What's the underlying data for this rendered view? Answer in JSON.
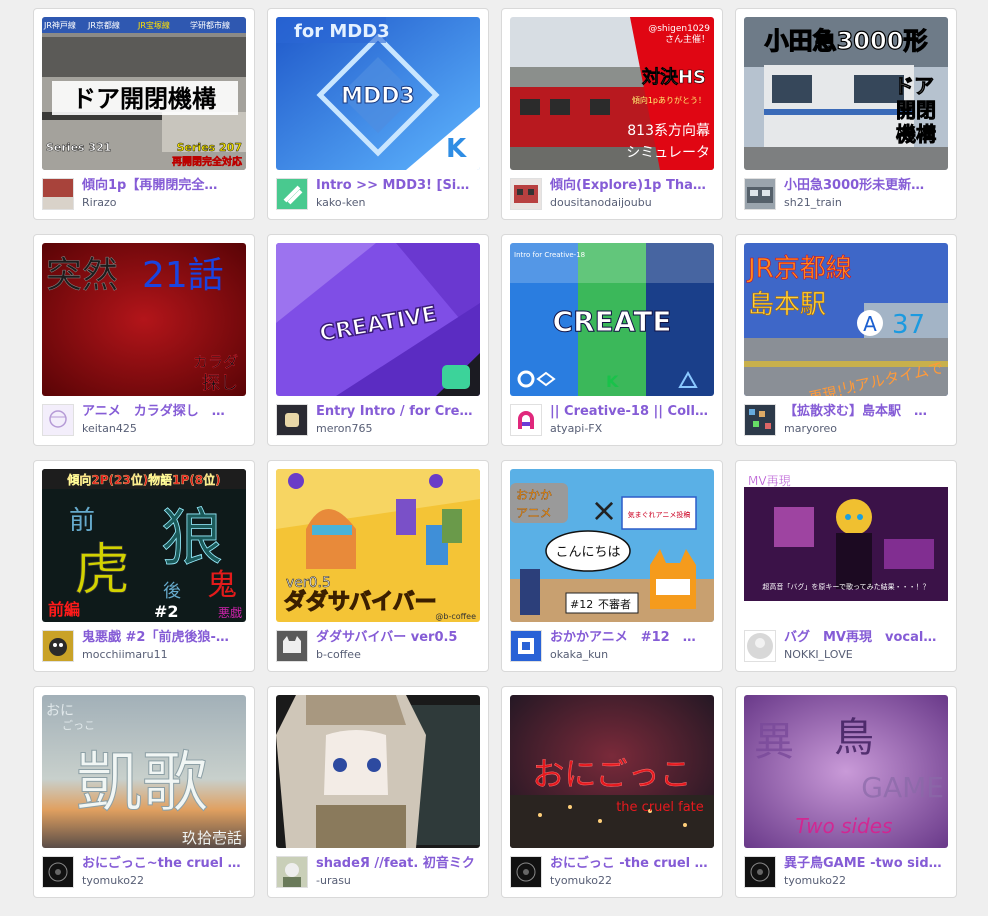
{
  "projects": [
    {
      "title": "傾向1p【再開閉完全…",
      "author": "Rirazo",
      "colors": {
        "thumb": "#8c8a86",
        "avatar": "#a8433b"
      }
    },
    {
      "title": "Intro >> MDD3! [Sign…",
      "author": "kako-ken",
      "colors": {
        "thumb": "#3a7ee8",
        "avatar": "#49c98f"
      }
    },
    {
      "title": "傾向(Explore)1p Tha…",
      "author": "dousitanodaijoubu",
      "colors": {
        "thumb": "#c62f2f",
        "avatar": "#b84040"
      }
    },
    {
      "title": "小田急3000形未更新…",
      "author": "sh21_train",
      "colors": {
        "thumb": "#7a8ca0",
        "avatar": "#55606a"
      }
    },
    {
      "title": "アニメ　カラダ探し　…",
      "author": "keitan425",
      "colors": {
        "thumb": "#8b0d0d",
        "avatar": "#f3eefb"
      }
    },
    {
      "title": "Entry Intro / for Creat…",
      "author": "meron765",
      "colors": {
        "thumb": "#7f4ee6",
        "avatar": "#2b2b33"
      }
    },
    {
      "title": "|| Creative-18 || Colla…",
      "author": "atyapi-FX",
      "colors": {
        "thumb": "#3a8ede",
        "avatar": "#ffffff"
      }
    },
    {
      "title": "【拡散求む】島本駅　…",
      "author": "maryoreo",
      "colors": {
        "thumb": "#3e67c8",
        "avatar": "#2d3a4a"
      }
    },
    {
      "title": "鬼悪戯 #2「前虎後狼-…",
      "author": "mocchiimaru11",
      "colors": {
        "thumb": "#0e1a1a",
        "avatar": "#c9a227"
      }
    },
    {
      "title": "ダダサバイバー ver0.5",
      "author": "b-coffee",
      "colors": {
        "thumb": "#f4c436",
        "avatar": "#5a5a5a"
      }
    },
    {
      "title": "おかかアニメ　#12　…",
      "author": "okaka_kun",
      "colors": {
        "thumb": "#5ab0e6",
        "avatar": "#2962d6"
      }
    },
    {
      "title": "バグ　MV再現　vocal…",
      "author": "NOKKI_LOVE",
      "colors": {
        "thumb": "#6d2a8a",
        "avatar": "#d8d8d8"
      }
    },
    {
      "title": "おにごっこ~the cruel …",
      "author": "tyomuko22",
      "colors": {
        "thumb": "#b9c4c6",
        "avatar": "#111111"
      }
    },
    {
      "title": "shadeЯ //feat. 初音ミク",
      "author": "-urasu",
      "colors": {
        "thumb": "#7d6b55",
        "avatar": "#c9cfb8"
      }
    },
    {
      "title": "おにごっこ -the cruel …",
      "author": "tyomuko22",
      "colors": {
        "thumb": "#4a2236",
        "avatar": "#111111"
      }
    },
    {
      "title": "異子鳥GAME -two sid…",
      "author": "tyomuko22",
      "colors": {
        "thumb": "#8a5ea8",
        "avatar": "#111111"
      }
    }
  ],
  "thumb_text": {
    "t0": {
      "lines": [
        "JR神戸線",
        "JR京都線",
        "JR宝塚線",
        "学研都市線"
      ],
      "main": "ドア開閉機構",
      "left": "Series 321",
      "right": "Series 207",
      "bottom": "再開閉完全対応"
    },
    "t1": {
      "top": "for MDD3",
      "main": "MDD3"
    },
    "t2": {
      "handle": "@shigen1029",
      "sub": "さん主催！",
      "main": "対決HS",
      "thanks": "傾向1pありがとう！",
      "bottom1": "813系方向幕",
      "bottom2": "シミュレータ"
    },
    "t3": {
      "main": "小田急3000形",
      "side1": "ドア",
      "side2": "開閉",
      "side3": "機構"
    },
    "t4": {
      "main1": "突然",
      "main2": "21話",
      "corner1": "カラダ",
      "corner2": "探し"
    },
    "t5": {
      "main": "CREATIVE"
    },
    "t6": {
      "top": "Intro for Creative-18",
      "main": "CREATE"
    },
    "t7": {
      "line1": "JR京都線",
      "line2": "島本駅",
      "mark": "A",
      "num": "37",
      "slogan1": "リアルタイムで",
      "slogan2": "再現！！"
    },
    "t8": {
      "top": "傾向2P(23位)物語1P(8位)",
      "big1": "狼",
      "big2": "虎",
      "big3": "鬼",
      "small1": "前",
      "small2": "後",
      "sub": "前編",
      "num": "#2",
      "end": "悪戯"
    },
    "t9": {
      "ver": "ver0.5",
      "main": "ダダサバイバー",
      "credit": "@b-coffee"
    },
    "t10": {
      "tag": "おかか",
      "tag2": "アニメ",
      "x": "×",
      "box": "気まぐれアニメ投稿",
      "speech": "こんにちは",
      "num": "#12",
      "num2": "不審者"
    },
    "t11": {
      "top": "MV再現",
      "bottom": "超高音「バグ」を原キーで歌ってみた結果・・・！？"
    },
    "t12": {
      "top1": "おに",
      "top2": "ごっこ",
      "main": "凱歌",
      "sub": "玖拾壱話"
    },
    "t13": {},
    "t14": {
      "main": "おにごっこ",
      "sub": "the cruel fate"
    },
    "t15": {
      "big1": "異",
      "big2": "鳥",
      "side": "GAME",
      "sub": "Two sides"
    }
  }
}
